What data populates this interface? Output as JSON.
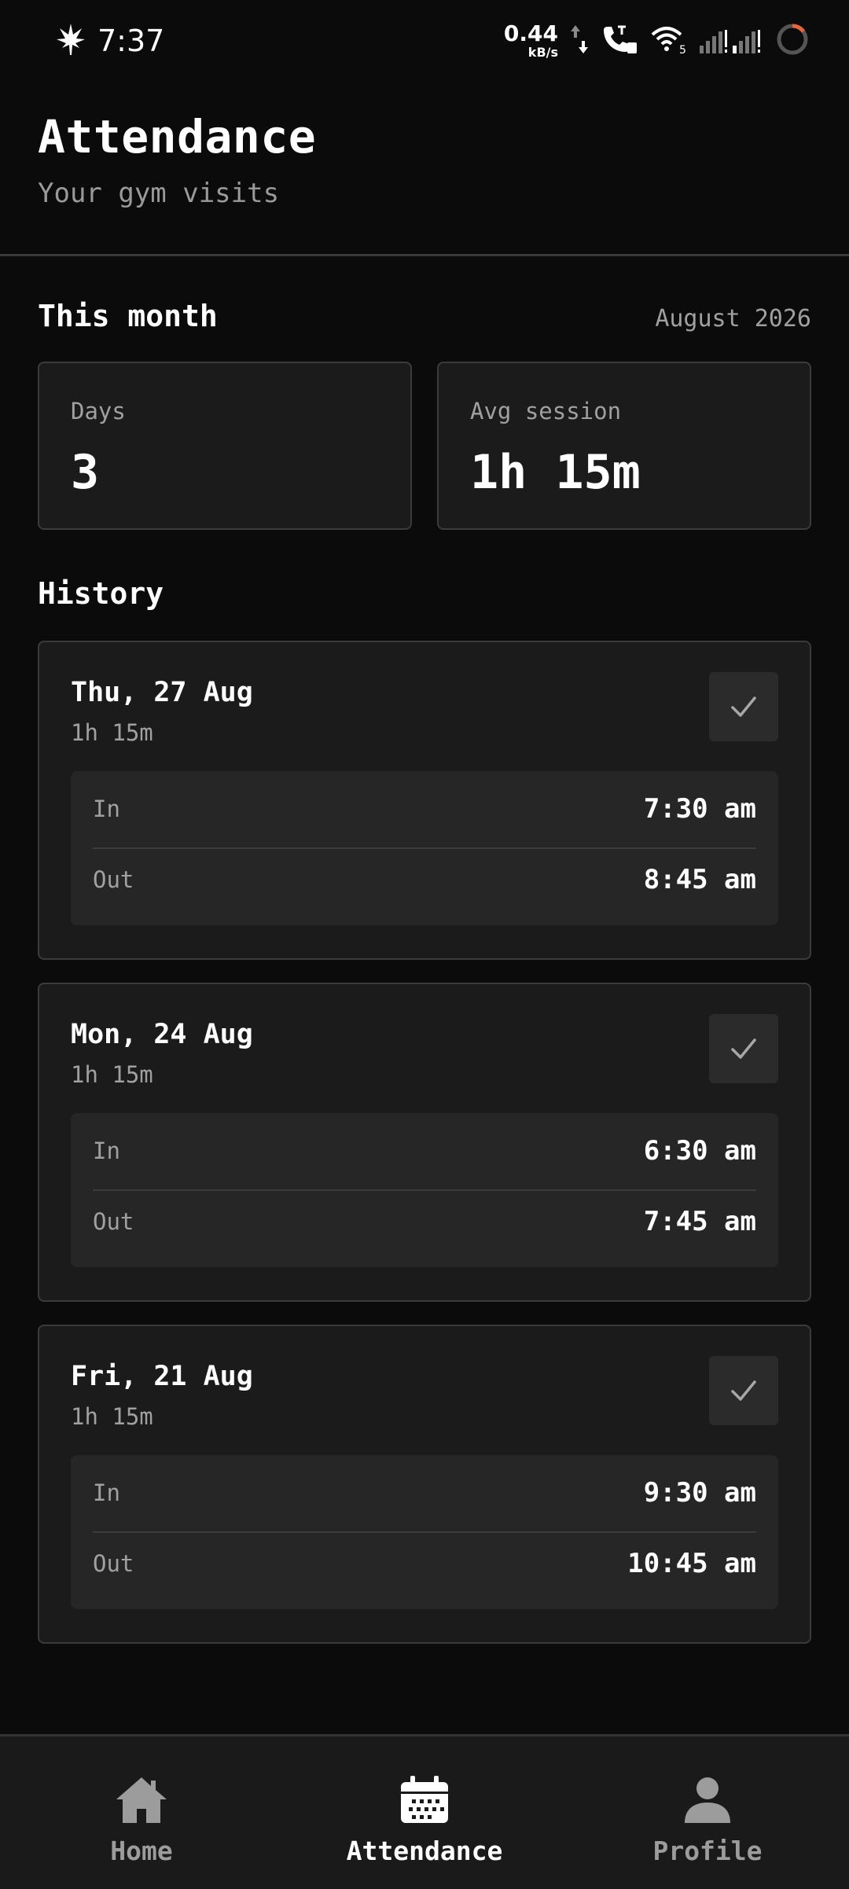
{
  "status_bar": {
    "time": "7:37",
    "net_speed": "0.44",
    "net_unit": "kB/s",
    "wifi_label": "5"
  },
  "header": {
    "title": "Attendance",
    "subtitle": "Your gym visits"
  },
  "this_month": {
    "title": "This month",
    "month_label": "August 2026",
    "stats": [
      {
        "label": "Days",
        "value": "3"
      },
      {
        "label": "Avg session",
        "value": "1h 15m"
      }
    ]
  },
  "history": {
    "title": "History",
    "in_label": "In",
    "out_label": "Out",
    "visits": [
      {
        "date": "Thu, 27 Aug",
        "duration": "1h 15m",
        "in": "7:30 am",
        "out": "8:45 am"
      },
      {
        "date": "Mon, 24 Aug",
        "duration": "1h 15m",
        "in": "6:30 am",
        "out": "7:45 am"
      },
      {
        "date": "Fri, 21 Aug",
        "duration": "1h 15m",
        "in": "9:30 am",
        "out": "10:45 am"
      }
    ]
  },
  "nav": {
    "items": [
      {
        "label": "Home",
        "icon": "home-icon"
      },
      {
        "label": "Attendance",
        "icon": "calendar-icon",
        "active": true
      },
      {
        "label": "Profile",
        "icon": "person-icon"
      }
    ]
  },
  "colors": {
    "background": "#0b0b0b",
    "card": "#1b1b1b",
    "inner_card": "#262626",
    "muted_text": "#a0a0a0"
  }
}
